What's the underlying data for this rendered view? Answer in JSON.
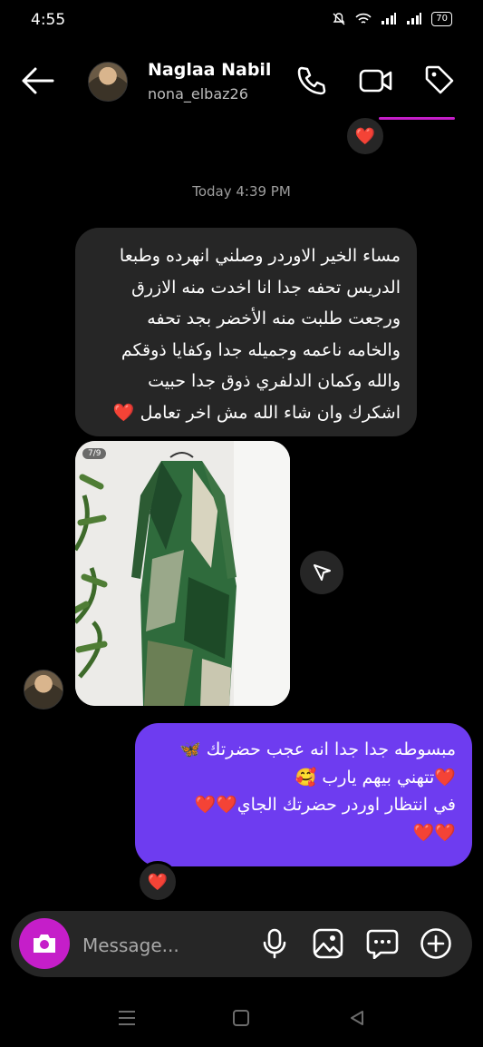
{
  "status_bar": {
    "time": "4:55",
    "battery": "70"
  },
  "header": {
    "display_name": "Naglaa Nabil",
    "username": "nona_elbaz26"
  },
  "conversation": {
    "timestamp": "Today 4:39 PM",
    "incoming_text": "مساء الخير الاوردر وصلني انهرده وطبعا الدريس تحفه جدا انا اخدت منه الازرق ورجعت طلبت منه الأخضر بجد تحفه والخامه ناعمه وجميله جدا وكفايا ذوقكم والله وكمان الدلفري ذوق جدا  حبيت اشكرك وان شاء الله مش اخر تعامل ❤️",
    "photo_counter": "7/9",
    "outgoing_lines": [
      "مبسوطه جدا جدا انه عجب حضرتك 🦋",
      "❤️تتهني بيهم  يارب 🥰",
      "في انتظار اوردر حضرتك الجاي❤️❤️",
      "❤️❤️"
    ],
    "reaction": "❤️"
  },
  "composer": {
    "placeholder": "Message..."
  },
  "colors": {
    "accent": "#c51ec9",
    "outgoing_bubble": "#6e3cf0",
    "incoming_bubble": "#262626"
  }
}
